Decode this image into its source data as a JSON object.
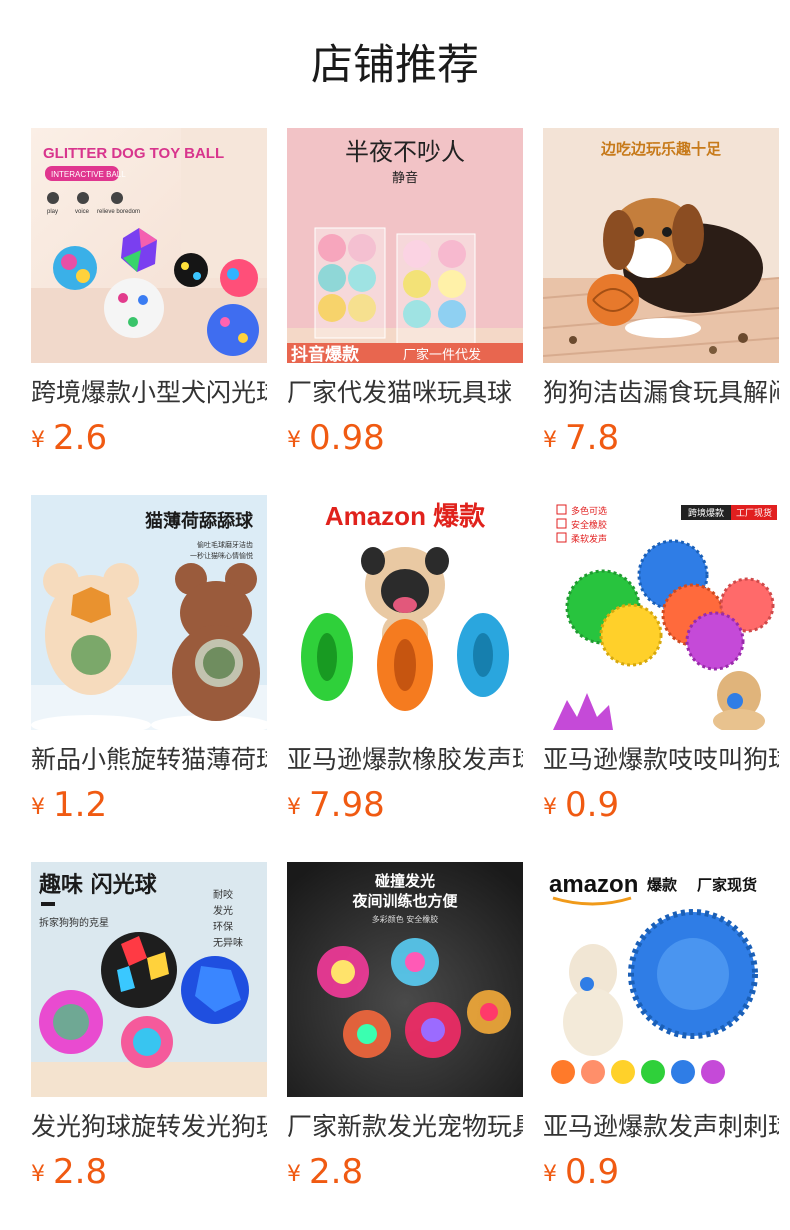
{
  "page": {
    "title": "店铺推荐"
  },
  "theme": {
    "price_color": "#f05a12",
    "title_color": "#1a1a1a",
    "name_color": "#333333"
  },
  "products": [
    {
      "name": "跨境爆款小型犬闪光球",
      "currency": "¥",
      "price": "2.6",
      "image": {
        "headline": "GLITTER DOG TOY BALL",
        "badge": "INTERACTIVE BALL",
        "features": [
          "play",
          "voice",
          "relieve boredom"
        ]
      }
    },
    {
      "name": "厂家代发猫咪玩具球",
      "currency": "¥",
      "price": "0.98",
      "image": {
        "headline": "半夜不吵人",
        "subhead": "静音",
        "banner": "抖音爆款",
        "banner_right": "厂家一件代发"
      }
    },
    {
      "name": "狗狗洁齿漏食玩具解闷",
      "currency": "¥",
      "price": "7.8",
      "image": {
        "headline": "边吃边玩乐趣十足"
      }
    },
    {
      "name": "新品小熊旋转猫薄荷球",
      "currency": "¥",
      "price": "1.2",
      "image": {
        "headline": "猫薄荷舔舔球",
        "sub1": "偷吐毛球磨牙洁齿",
        "sub2": "一秒让猫咪心情愉悦"
      }
    },
    {
      "name": "亚马逊爆款橡胶发声球",
      "currency": "¥",
      "price": "7.98",
      "image": {
        "headline": "Amazon 爆款"
      }
    },
    {
      "name": "亚马逊爆款吱吱叫狗球",
      "currency": "¥",
      "price": "0.9",
      "image": {
        "checks": [
          "多色可选",
          "安全橡胶",
          "柔软发声"
        ],
        "tag_left": "跨境爆款",
        "tag_right": "工厂现货"
      }
    },
    {
      "name": "发光狗球旋转发光狗玩具",
      "currency": "¥",
      "price": "2.8",
      "image": {
        "headline": "趣味 闪光球",
        "sub": "拆家狗狗的克星",
        "features": [
          "耐咬",
          "发光",
          "环保",
          "无异味"
        ]
      }
    },
    {
      "name": "厂家新款发光宠物玩具",
      "currency": "¥",
      "price": "2.8",
      "image": {
        "headline1": "碰撞发光",
        "headline2": "夜间训练也方便",
        "sub": "多彩颜色 安全橡胶"
      }
    },
    {
      "name": "亚马逊爆款发声刺刺球",
      "currency": "¥",
      "price": "0.9",
      "image": {
        "brand": "amazon",
        "headline": "爆款",
        "headline_right": "厂家现货"
      }
    }
  ]
}
